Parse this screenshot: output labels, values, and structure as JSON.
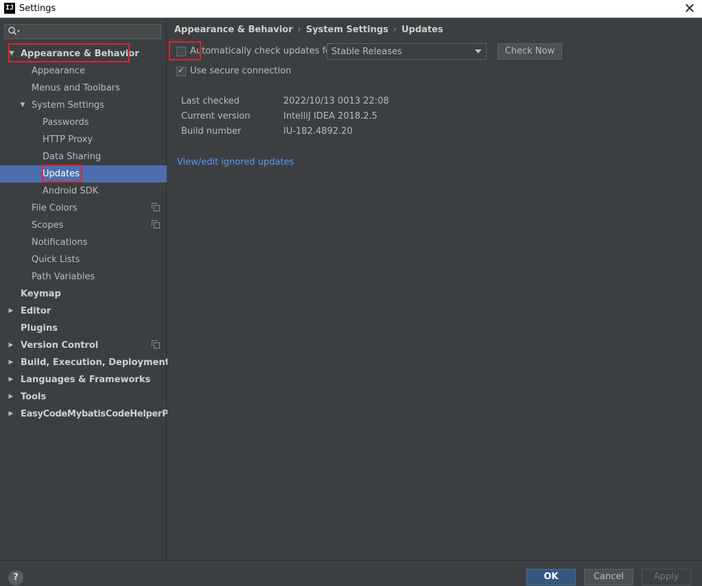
{
  "window": {
    "title": "Settings",
    "app_icon": "IJ",
    "close_glyph": "✕"
  },
  "sidebar": {
    "search_placeholder": "",
    "items": [
      {
        "label": "Appearance & Behavior",
        "arrow": "▼"
      },
      {
        "label": "Appearance"
      },
      {
        "label": "Menus and Toolbars"
      },
      {
        "label": "System Settings",
        "arrow": "▼"
      },
      {
        "label": "Passwords"
      },
      {
        "label": "HTTP Proxy"
      },
      {
        "label": "Data Sharing"
      },
      {
        "label": "Updates"
      },
      {
        "label": "Android SDK"
      },
      {
        "label": "File Colors"
      },
      {
        "label": "Scopes"
      },
      {
        "label": "Notifications"
      },
      {
        "label": "Quick Lists"
      },
      {
        "label": "Path Variables"
      },
      {
        "label": "Keymap"
      },
      {
        "label": "Editor",
        "arrow": "▶"
      },
      {
        "label": "Plugins"
      },
      {
        "label": "Version Control",
        "arrow": "▶"
      },
      {
        "label": "Build, Execution, Deployment",
        "arrow": "▶"
      },
      {
        "label": "Languages & Frameworks",
        "arrow": "▶"
      },
      {
        "label": "Tools",
        "arrow": "▶"
      },
      {
        "label": "EasyCodeMybatisCodeHelperPro",
        "arrow": "▶"
      }
    ]
  },
  "breadcrumb": {
    "part1": "Appearance & Behavior",
    "part2": "System Settings",
    "part3": "Updates",
    "separator": "›"
  },
  "updates": {
    "auto_check_label": "Automatically check updates for",
    "auto_check_checked": false,
    "channel": "Stable Releases",
    "check_now_label": "Check Now",
    "secure_label": "Use secure connection",
    "secure_checked": true,
    "info": [
      {
        "label": "Last checked",
        "value": "2022/10/13 0013 22:08"
      },
      {
        "label": "Current version",
        "value": "IntelliJ IDEA 2018.2.5"
      },
      {
        "label": "Build number",
        "value": "IU-182.4892.20"
      }
    ],
    "ignored_link": "View/edit ignored updates"
  },
  "footer": {
    "help": "?",
    "ok": "OK",
    "cancel": "Cancel",
    "apply": "Apply"
  },
  "colors": {
    "background": "#3c3f41",
    "selection": "#4b6eaf",
    "link": "#589df6",
    "highlight_box": "#e0242e",
    "ok_button": "#365880"
  }
}
